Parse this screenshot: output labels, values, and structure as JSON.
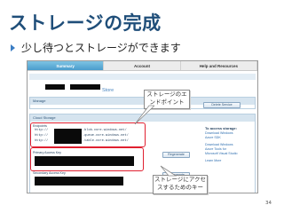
{
  "slide": {
    "title": "ストレージの完成",
    "bullet": "少し待つとストレージができます",
    "page_number": "34"
  },
  "portal": {
    "tabs": [
      {
        "label": "Summary",
        "active": true
      },
      {
        "label": "Account",
        "active": false
      },
      {
        "label": "Help and Resources",
        "active": false
      }
    ],
    "store_label": "Store",
    "manage_label": "Manage",
    "delete_service": "Delete Service",
    "cloud_storage": "Cloud Storage",
    "endpoints_label": "Endpoints",
    "endpoints": [
      "http://",
      "http://",
      "http://"
    ],
    "endpoint_suffixes": [
      ".blob.core.windows.net/",
      ".queue.core.windows.net/",
      ".table.core.windows.net/"
    ],
    "primary_key_label": "Primary Access Key",
    "secondary_key_label": "Secondary Access Key",
    "regenerate": "Regenerate",
    "side_head": "To access storage:",
    "side_links": [
      "Download Windows",
      "Azure SDK",
      "Download Windows",
      "Azure Tools for",
      "Microsoft Visual Studio",
      "Learn More"
    ]
  },
  "callouts": {
    "endpoint_note": "ストレージのエンドポイント",
    "key_note": "ストレージにアクセスするためのキー"
  },
  "colors": {
    "title": "#1f4e79",
    "highlight": "#e02030",
    "active_tab": "#4a9ccc"
  }
}
